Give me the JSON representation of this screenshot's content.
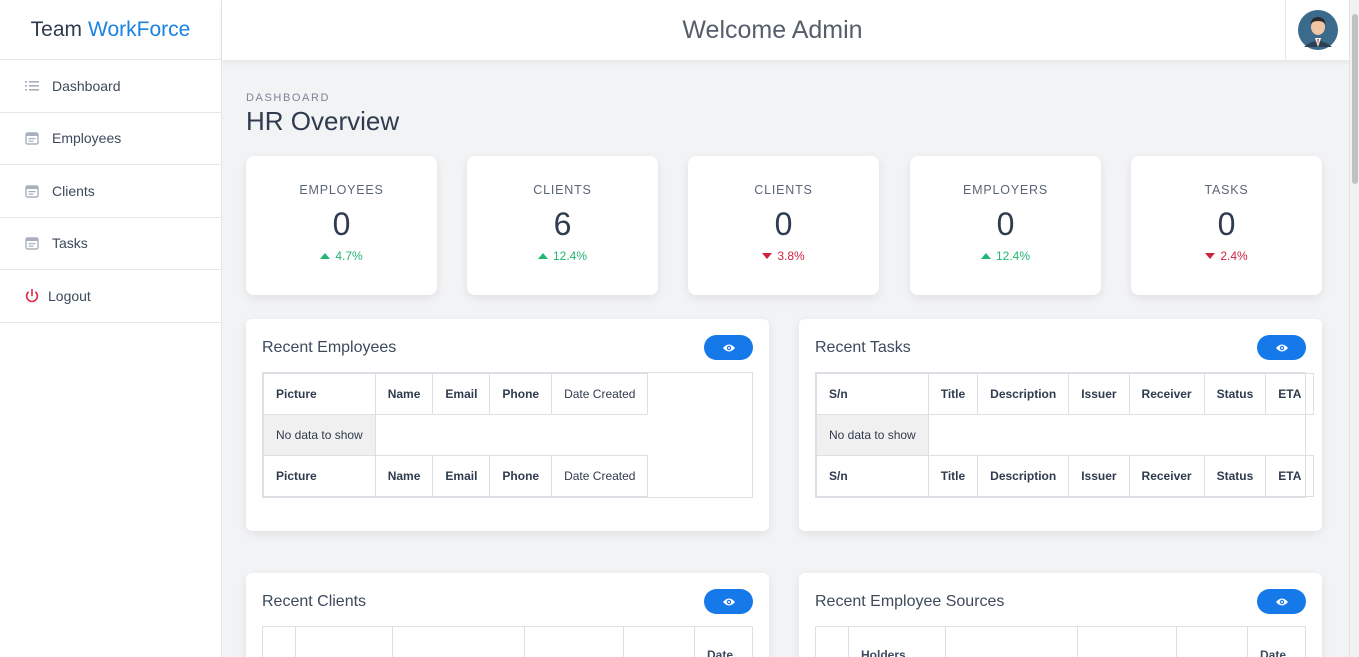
{
  "brand": {
    "prefix": "Team",
    "accent": "WorkForce",
    "accent_color": "#1a82e2"
  },
  "sidebar": {
    "items": [
      {
        "label": "Dashboard",
        "icon": "list-icon"
      },
      {
        "label": "Employees",
        "icon": "calendar-icon"
      },
      {
        "label": "Clients",
        "icon": "calendar-icon"
      },
      {
        "label": "Tasks",
        "icon": "calendar-icon"
      },
      {
        "label": "Logout",
        "icon": "power-icon"
      }
    ]
  },
  "header": {
    "title": "Welcome Admin",
    "avatar": "admin-avatar"
  },
  "page": {
    "breadcrumb": "DASHBOARD",
    "title": "HR Overview"
  },
  "stats": [
    {
      "label": "EMPLOYEES",
      "value": "0",
      "delta": "4.7%",
      "trend": "up"
    },
    {
      "label": "CLIENTS",
      "value": "6",
      "delta": "12.4%",
      "trend": "up"
    },
    {
      "label": "CLIENTS",
      "value": "0",
      "delta": "3.8%",
      "trend": "down"
    },
    {
      "label": "EMPLOYERS",
      "value": "0",
      "delta": "12.4%",
      "trend": "up"
    },
    {
      "label": "TASKS",
      "value": "0",
      "delta": "2.4%",
      "trend": "down"
    }
  ],
  "colors": {
    "up": "#22b573",
    "down": "#d0223f",
    "button": "#1679ea"
  },
  "panels": {
    "recent_employees": {
      "title": "Recent Employees",
      "columns": [
        "Picture",
        "Name",
        "Email",
        "Phone",
        "Date Created"
      ],
      "empty_text": "No data to show"
    },
    "recent_tasks": {
      "title": "Recent Tasks",
      "columns": [
        "S/n",
        "Title",
        "Description",
        "Issuer",
        "Receiver",
        "Status",
        "ETA"
      ],
      "empty_text": "No data to show"
    },
    "recent_clients": {
      "title": "Recent Clients",
      "visible_headers": [
        "",
        "",
        "",
        "",
        "",
        "Date"
      ]
    },
    "recent_employee_sources": {
      "title": "Recent Employee Sources",
      "visible_headers": [
        "",
        "Holders",
        "",
        "",
        "",
        "Date"
      ]
    }
  }
}
